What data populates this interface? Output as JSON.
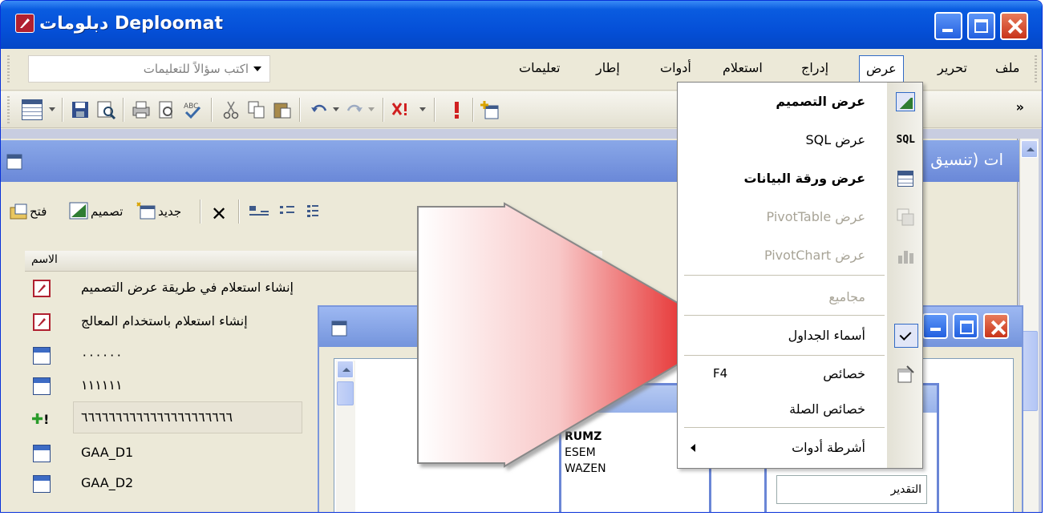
{
  "window": {
    "title": "Deploomat دبلومات",
    "buttons": [
      "minimize",
      "maximize",
      "close"
    ]
  },
  "menubar": {
    "items": [
      "ملف",
      "تحرير",
      "عرض",
      "إدراج",
      "استعلام",
      "أدوات",
      "إطار",
      "تعليمات"
    ],
    "active": "عرض",
    "ask_placeholder": "اكتب سؤالاً للتعليمات"
  },
  "toolbar": {
    "icons": [
      "view-icon",
      "save-icon",
      "search-icon",
      "print-icon",
      "print-preview-icon",
      "spelling-icon",
      "cut-icon",
      "copy-icon",
      "paste-icon",
      "undo-icon",
      "redo-icon",
      "delete-icon",
      "run-icon",
      "show-table-icon",
      "properties-icon",
      "build-icon"
    ]
  },
  "db_window": {
    "title": "ات (تنسيق",
    "actions": {
      "open": "فتح",
      "design": "تصميم",
      "new": "جديد"
    },
    "column_header": "الاسم",
    "items": [
      {
        "label": "إنشاء استعلام في طريقة عرض التصميم",
        "icon": "create-design-icon"
      },
      {
        "label": "إنشاء استعلام باستخدام المعالج",
        "icon": "create-wizard-icon"
      },
      {
        "label": "٠٠٠٠٠٠",
        "icon": "query-icon"
      },
      {
        "label": "١١١١١١",
        "icon": "query-icon"
      },
      {
        "label": "٦٦٦٦٦٦٦٦٦٦٦٦٦٦٦٦٦٦٦٦٦٦",
        "icon": "append-query-icon"
      },
      {
        "label": "GAA_D1",
        "icon": "query-icon"
      },
      {
        "label": "GAA_D2",
        "icon": "query-icon"
      }
    ]
  },
  "query_design": {
    "fields_left": [
      "*",
      "RUMZ",
      "ESEM",
      "WAZEN"
    ],
    "fields_right": [
      "التقدير"
    ]
  },
  "view_menu": {
    "items": [
      {
        "label": "عرض التصميم",
        "icon": "design-view-icon",
        "bold": true,
        "enabled": true
      },
      {
        "label": "عرض SQL",
        "icon": "sql-icon",
        "bold": false,
        "enabled": true
      },
      {
        "label": "عرض ورقة البيانات",
        "icon": "datasheet-icon",
        "bold": true,
        "enabled": true
      },
      {
        "label": "عرض PivotTable",
        "icon": "pivottable-icon",
        "bold": false,
        "enabled": false
      },
      {
        "label": "عرض PivotChart",
        "icon": "pivotchart-icon",
        "bold": false,
        "enabled": false
      },
      {
        "label": "مجاميع",
        "icon": "",
        "bold": false,
        "enabled": false
      },
      {
        "label": "أسماء الجداول",
        "icon": "check-icon",
        "bold": false,
        "enabled": true,
        "checked": true
      },
      {
        "label": "خصائص",
        "shortcut": "F4",
        "icon": "properties-icon",
        "bold": false,
        "enabled": true
      },
      {
        "label": "خصائص الصلة",
        "icon": "",
        "bold": false,
        "enabled": true
      },
      {
        "label": "أشرطة أدوات",
        "icon": "",
        "bold": false,
        "enabled": true,
        "submenu": true
      }
    ]
  },
  "colors": {
    "titlebar": "#0550d8",
    "menu_highlight": "#316ac5",
    "arrow": "#e00000"
  }
}
